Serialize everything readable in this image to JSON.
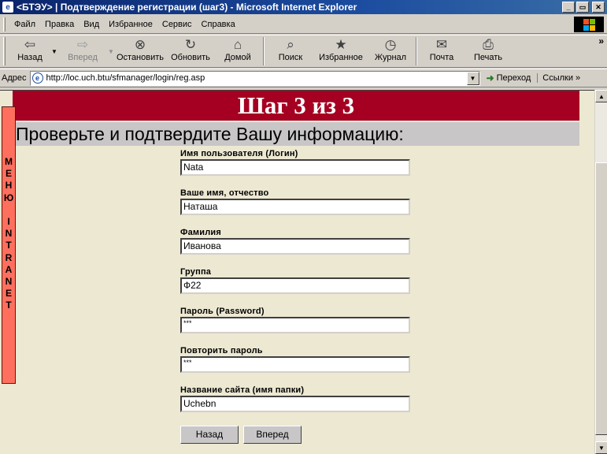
{
  "window": {
    "title": "<БТЭУ> | Подтверждение регистрации (шаг3) - Microsoft Internet Explorer",
    "minimize": "_",
    "maximize": "▭",
    "close": "✕"
  },
  "menu": {
    "items": [
      "Файл",
      "Правка",
      "Вид",
      "Избранное",
      "Сервис",
      "Справка"
    ]
  },
  "toolbar": {
    "back": "Назад",
    "forward": "Вперед",
    "stop": "Остановить",
    "refresh": "Обновить",
    "home": "Домой",
    "search": "Поиск",
    "favorites": "Избранное",
    "history": "Журнал",
    "mail": "Почта",
    "print": "Печать",
    "more": "»"
  },
  "address": {
    "label": "Адрес",
    "url": "http://loc.uch.btu/sfmanager/login/reg.asp",
    "go": "Переход",
    "links": "Ссылки"
  },
  "page": {
    "banner": "Шаг 3 из 3",
    "subheader": "Проверьте и подтвердите Вашу информацию:",
    "side_menu": [
      "М",
      "Е",
      "Н",
      "Ю",
      " ",
      "I",
      "N",
      "T",
      "R",
      "A",
      "N",
      "E",
      "T"
    ],
    "fields": [
      {
        "label": "Имя пользователя (Логин)",
        "value": "Nata"
      },
      {
        "label": "Ваше имя, отчество",
        "value": "Наташа"
      },
      {
        "label": "Фамилия",
        "value": "Иванова"
      },
      {
        "label": "Группа",
        "value": "Ф22"
      },
      {
        "label": "Пароль (Password)",
        "value": "***"
      },
      {
        "label": "Повторить пароль",
        "value": "***"
      },
      {
        "label": "Название сайта (имя папки)",
        "value": "Uchebn"
      }
    ],
    "back_button": "Назад",
    "next_button": "Вперед"
  },
  "colors": {
    "banner_bg": "#a50021",
    "page_bg": "#ece8d2",
    "side_menu_bg": "#ff6f5e"
  }
}
